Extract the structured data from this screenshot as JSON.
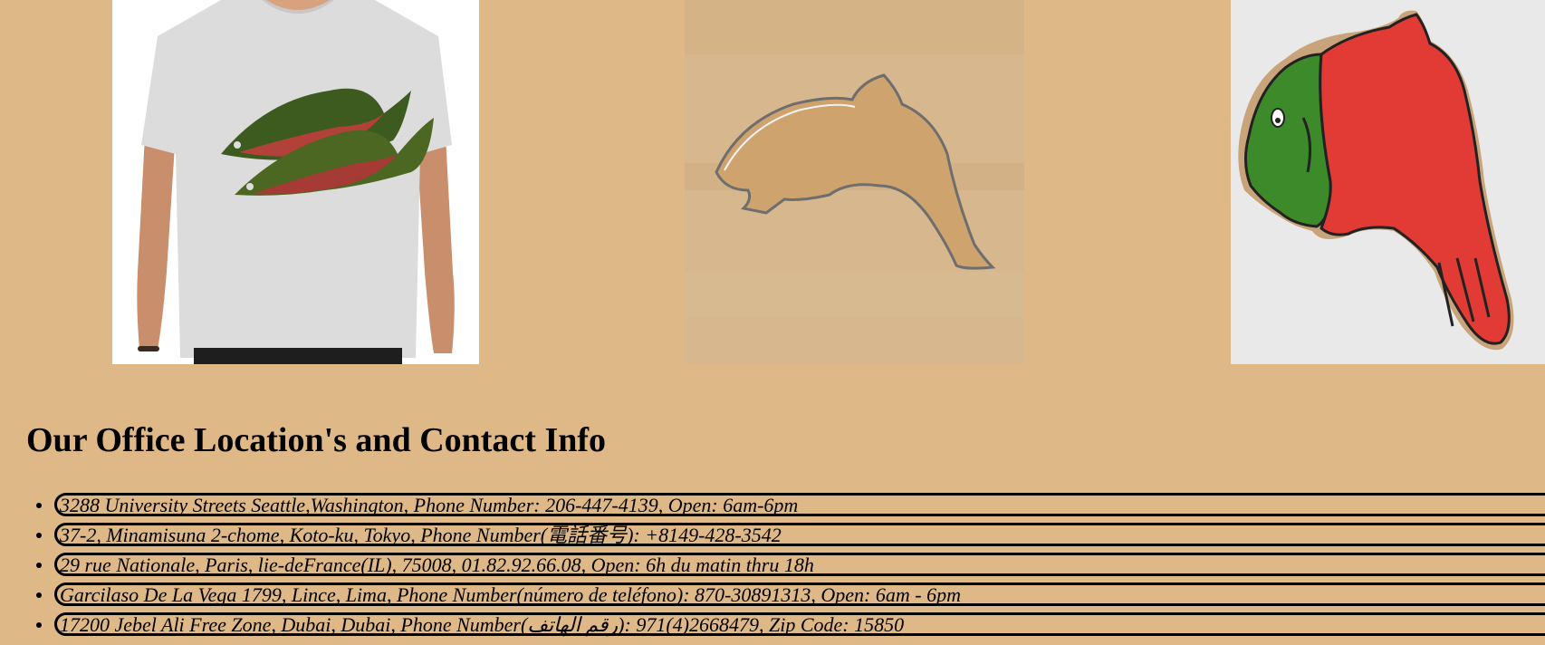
{
  "gallery": {
    "images": [
      {
        "name": "salmon-tshirt-image"
      },
      {
        "name": "salmon-cookie-cutter-image"
      },
      {
        "name": "salmon-cookie-image"
      }
    ]
  },
  "contact": {
    "heading": "Our Office Location's and Contact Info",
    "locations": [
      "3288 University Streets Seattle,Washington, Phone Number: 206-447-4139, Open: 6am-6pm",
      "37-2, Minamisuna 2-chome, Koto-ku, Tokyo, Phone Number(電話番号): +8149-428-3542",
      "29 rue Nationale, Paris, lie-deFrance(IL), 75008, 01.82.92.66.08, Open: 6h du matin thru 18h",
      "Garcilaso De La Vega 1799, Lince, Lima, Phone Number(número de teléfono): 870-30891313, Open: 6am - 6pm",
      "17200 Jebel Ali Free Zone, Dubai, Dubai, Phone Number(رقم الهاتف): 2668479(4)971, Zip Code: 15850"
    ]
  },
  "colors": {
    "background": "#DEB887",
    "text": "#000000"
  }
}
